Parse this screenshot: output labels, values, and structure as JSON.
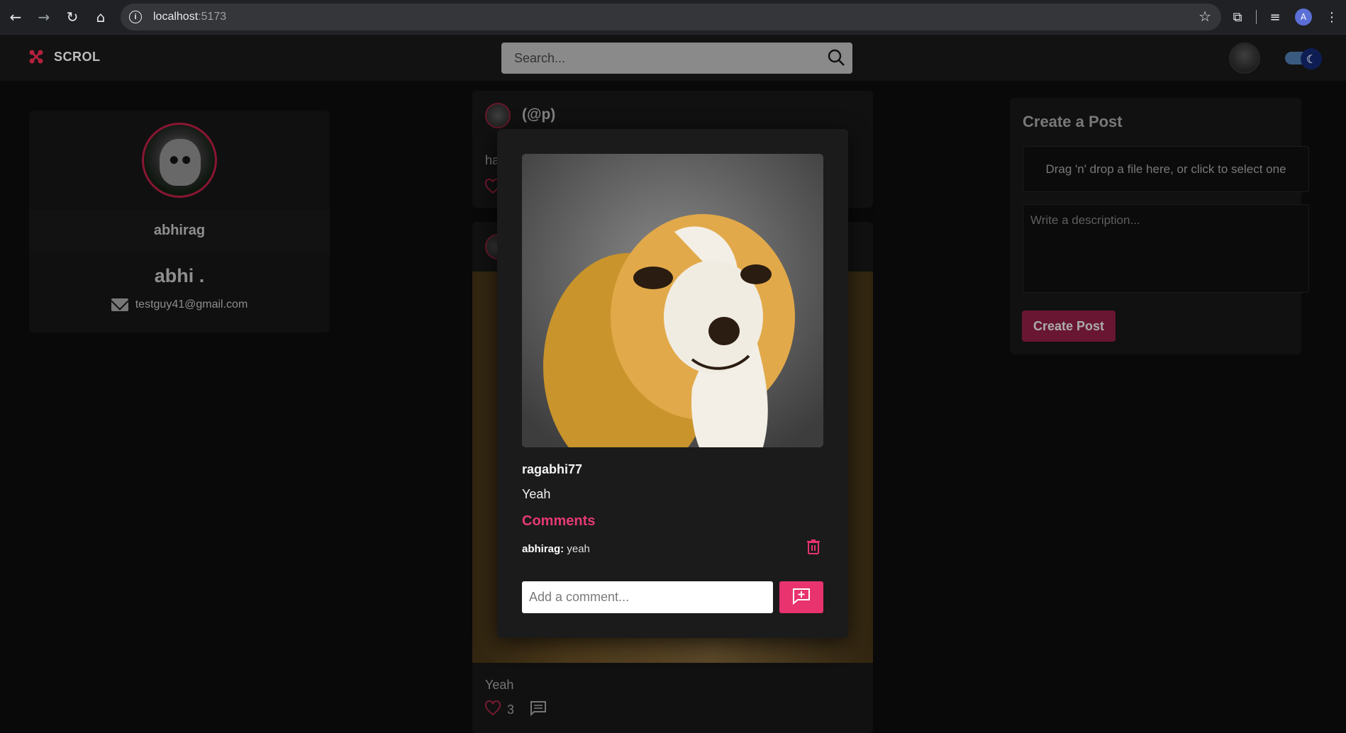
{
  "browser": {
    "url_host": "localhost",
    "url_port": ":5173"
  },
  "navbar": {
    "brand": "SCROL",
    "search_placeholder": "Search..."
  },
  "profile": {
    "username": "abhirag",
    "display_name": "abhi .",
    "email": "testguy41@gmail.com"
  },
  "feed": {
    "post1": {
      "handle": "(@p)",
      "description_visible": "ha"
    },
    "post2": {
      "caption": "Yeah",
      "likes": "3"
    }
  },
  "create_post": {
    "title": "Create a Post",
    "dropzone_text": "Drag 'n' drop a file here, or click to select one",
    "description_placeholder": "Write a description...",
    "button_label": "Create Post"
  },
  "modal": {
    "username": "ragabhi77",
    "description": "Yeah",
    "comments_heading": "Comments",
    "comments": [
      {
        "author": "abhirag:",
        "text": "yeah"
      }
    ],
    "comment_placeholder": "Add a comment..."
  },
  "colors": {
    "accent": "#e8336f",
    "brand_dark": "#7c1a3b",
    "background": "#0b0b0b"
  }
}
